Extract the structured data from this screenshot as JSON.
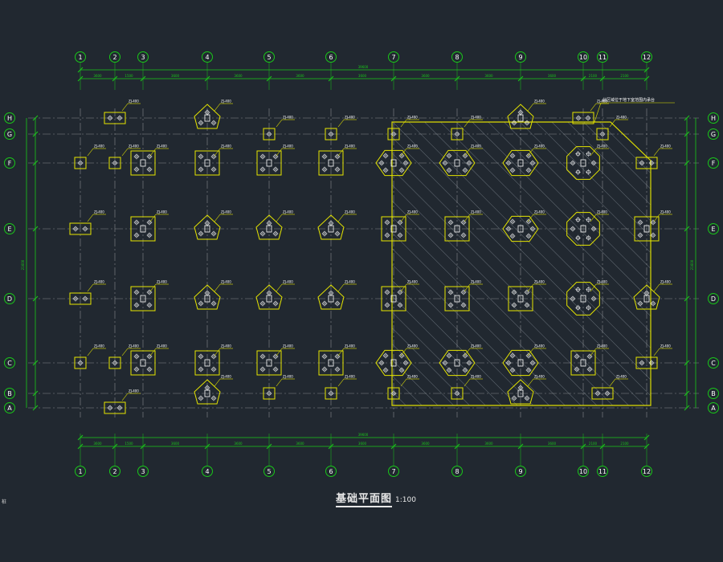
{
  "drawing": {
    "title": "基础平面图",
    "scale": "1:100",
    "corner_mark": "桩"
  },
  "axes": {
    "columns": [
      "1",
      "2",
      "3",
      "4",
      "5",
      "6",
      "7",
      "8",
      "9",
      "10",
      "11",
      "12"
    ],
    "rows": [
      "A",
      "B",
      "C",
      "D",
      "E",
      "F",
      "G",
      "H"
    ]
  },
  "dims": {
    "top_segments": [
      "3600",
      "1500",
      "3600",
      "3600",
      "3600",
      "3600",
      "3600",
      "3600",
      "3600",
      "2100",
      "2100"
    ],
    "top_total": "39600",
    "bottom_segments": [
      "3600",
      "1500",
      "3600",
      "3600",
      "3600",
      "3600",
      "3600",
      "3600",
      "3600",
      "2100",
      "2100"
    ],
    "bottom_total": "39600",
    "side_total": "21600"
  },
  "labels": {
    "pile_cap_prefix": "ZJ",
    "pile_size": "400",
    "note": "此区域位于地下室范围内承台"
  },
  "colors": {
    "background": "#212830",
    "grid": "#d9d9d9",
    "dimension": "#19c819",
    "cap": "#e6e600",
    "pile": "#ffffff",
    "leader": "#e6e600",
    "hatch": "#9aa3ad"
  }
}
